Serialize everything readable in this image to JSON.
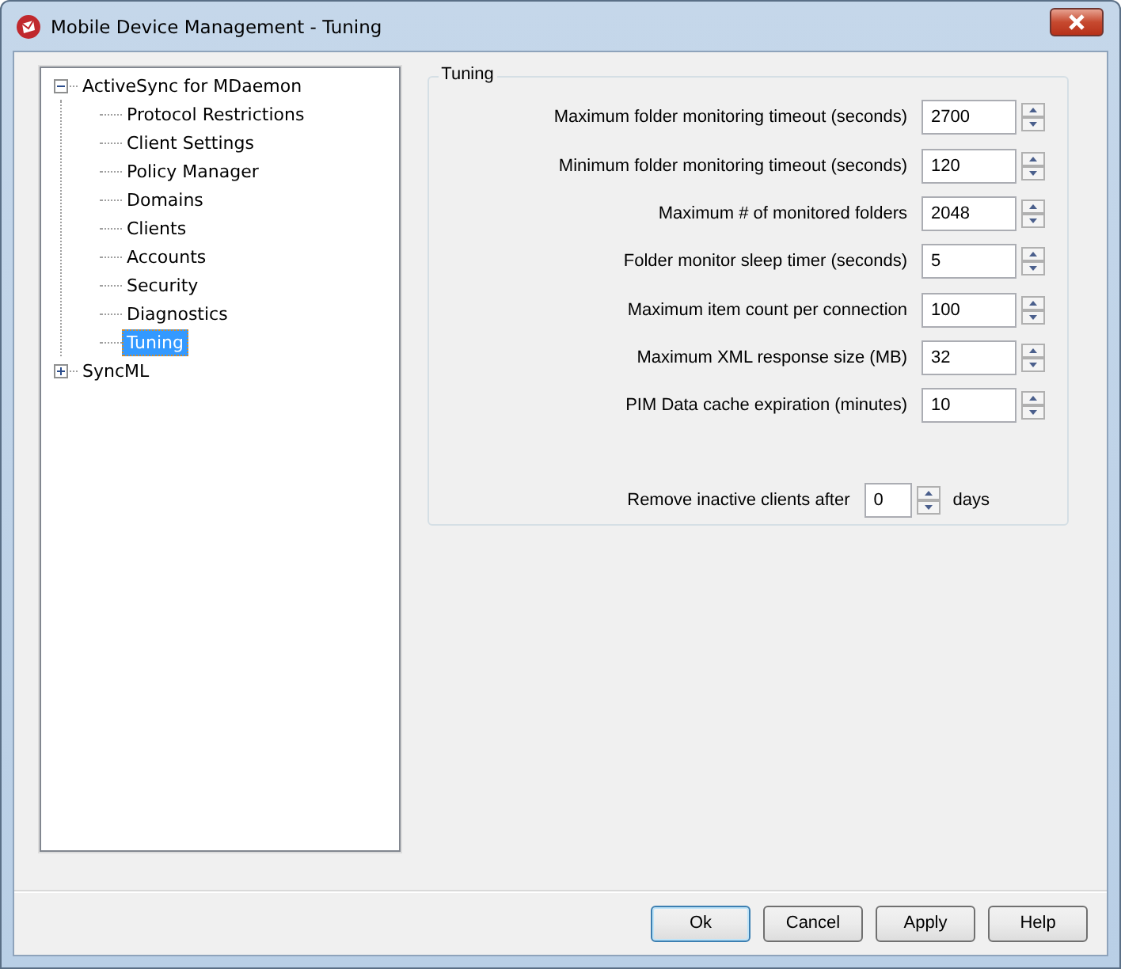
{
  "window": {
    "title": "Mobile Device Management - Tuning"
  },
  "tree": [
    {
      "label": "ActiveSync for MDaemon",
      "expanded": true,
      "selected": false,
      "children": [
        {
          "label": "Protocol Restrictions",
          "selected": false
        },
        {
          "label": "Client Settings",
          "selected": false
        },
        {
          "label": "Policy Manager",
          "selected": false
        },
        {
          "label": "Domains",
          "selected": false
        },
        {
          "label": "Clients",
          "selected": false
        },
        {
          "label": "Accounts",
          "selected": false
        },
        {
          "label": "Security",
          "selected": false
        },
        {
          "label": "Diagnostics",
          "selected": false
        },
        {
          "label": "Tuning",
          "selected": true
        }
      ]
    },
    {
      "label": "SyncML",
      "expanded": false,
      "selected": false
    }
  ],
  "group": {
    "title": "Tuning",
    "fields": [
      {
        "label": "Maximum folder monitoring timeout (seconds)",
        "value": "2700"
      },
      {
        "label": "Minimum folder monitoring timeout (seconds)",
        "value": "120"
      },
      {
        "label": "Maximum # of monitored folders",
        "value": "2048"
      },
      {
        "label": "Folder monitor sleep timer (seconds)",
        "value": "5"
      },
      {
        "label": "Maximum item count per connection",
        "value": "100"
      },
      {
        "label": "Maximum XML response size (MB)",
        "value": "32"
      },
      {
        "label": "PIM Data cache expiration (minutes)",
        "value": "10"
      }
    ],
    "inactive": {
      "label": "Remove inactive clients after",
      "value": "0",
      "unit": "days"
    }
  },
  "buttons": [
    {
      "label": "Ok",
      "default": true
    },
    {
      "label": "Cancel",
      "default": false
    },
    {
      "label": "Apply",
      "default": false
    },
    {
      "label": "Help",
      "default": false
    }
  ]
}
